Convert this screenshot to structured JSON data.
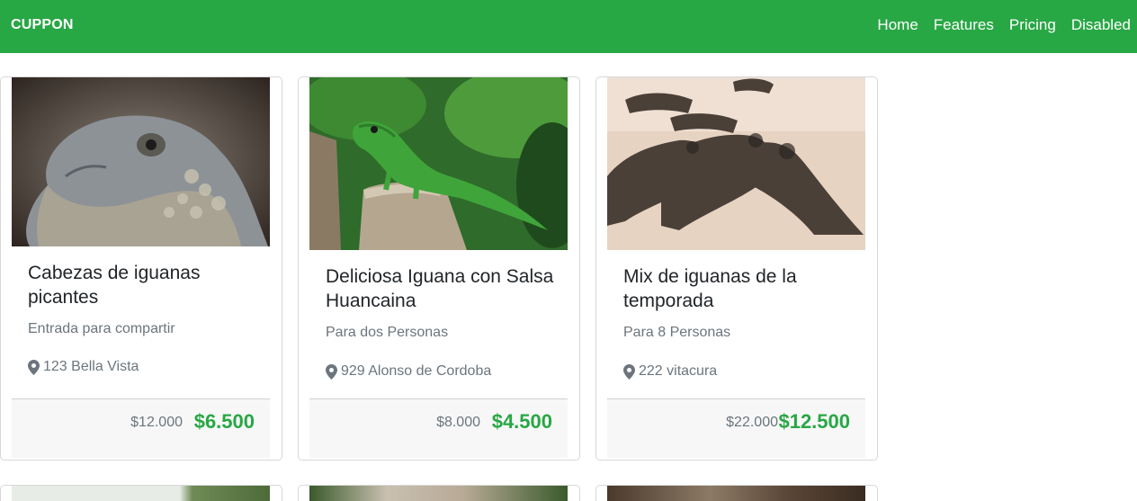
{
  "brand": "CUPPON",
  "nav": [
    "Home",
    "Features",
    "Pricing",
    "Disabled"
  ],
  "cards": [
    {
      "title": "Cabezas de iguanas picantes",
      "subtitle": "Entrada para compartir",
      "address": "123 Bella Vista",
      "old_price": "$12.000",
      "new_price": "$6.500"
    },
    {
      "title": "Deliciosa Iguana con Salsa Huancaina",
      "subtitle": "Para dos Personas",
      "address": "929 Alonso de Cordoba",
      "old_price": "$8.000",
      "new_price": "$4.500"
    },
    {
      "title": "Mix de iguanas de la temporada",
      "subtitle": "Para 8 Personas",
      "address": "222 vitacura",
      "old_price": "$22.000",
      "new_price": "$12.500"
    }
  ],
  "colors": {
    "navbar": "#28a745",
    "price": "#28a745",
    "muted": "#6c757d"
  }
}
